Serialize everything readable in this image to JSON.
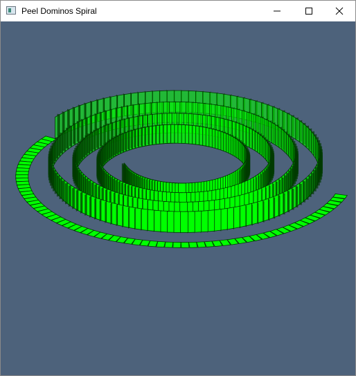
{
  "window": {
    "title": "Peel Dominos Spiral",
    "controls": {
      "minimize": "minimize-icon",
      "maximize": "maximize-icon",
      "close": "close-icon"
    }
  },
  "scene": {
    "background_color": "#4d627b",
    "domino_color": "#00ff00",
    "domino_shadow_color": "#003a00",
    "description_icon": "spiral-domino-scene"
  }
}
